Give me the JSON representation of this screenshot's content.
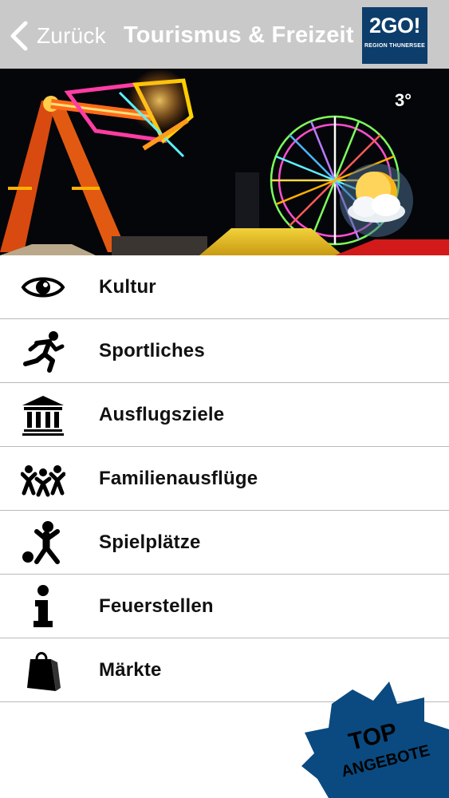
{
  "nav": {
    "back_label": "Zurück",
    "title": "Tourismus & Freizeit",
    "logo_main": "2GO!",
    "logo_sub": "REGION THUNERSEE"
  },
  "weather": {
    "temperature": "3°",
    "icon": "partly-cloudy-icon"
  },
  "menu": {
    "items": [
      {
        "label": "Kultur",
        "icon": "eye-icon"
      },
      {
        "label": "Sportliches",
        "icon": "runner-icon"
      },
      {
        "label": "Ausflugsziele",
        "icon": "museum-icon"
      },
      {
        "label": "Familienausflüge",
        "icon": "family-icon"
      },
      {
        "label": "Spielplätze",
        "icon": "playground-icon"
      },
      {
        "label": "Feuerstellen",
        "icon": "info-icon"
      },
      {
        "label": "Märkte",
        "icon": "shopping-bag-icon"
      }
    ]
  },
  "badge": {
    "line1": "TOP",
    "line2": "ANGEBOTE"
  },
  "colors": {
    "nav_background": "#c9c9c9",
    "brand_blue": "#0d3d6b",
    "badge_blue": "#0a4a80",
    "separator": "#b9b9b9"
  }
}
